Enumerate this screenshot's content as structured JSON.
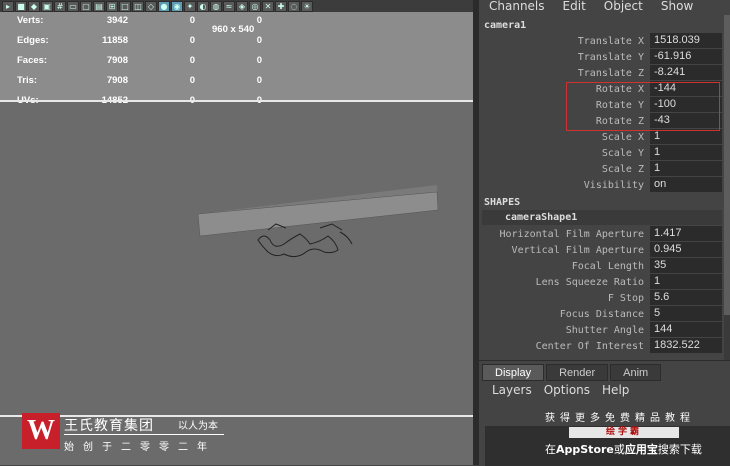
{
  "toolbar": {
    "icons": [
      "select-icon",
      "camera-icon",
      "bookmark-icon",
      "image-plane-icon",
      "grid-icon",
      "film-gate-icon",
      "resolution-gate-icon",
      "gate-mask-icon",
      "field-chart-icon",
      "safe-action-icon",
      "safe-title-icon",
      "wireframe-icon",
      "smooth-shade-icon",
      "textured-icon",
      "lights-icon",
      "shadows-icon",
      "ambient-occlusion-icon",
      "motion-blur-icon",
      "anti-alias-icon",
      "isolate-icon",
      "xray-icon",
      "xray-joints-icon",
      "xray-components-icon",
      "exposure-icon"
    ]
  },
  "hud": {
    "rows": [
      {
        "label": "Verts:",
        "v1": "3942",
        "v2": "0",
        "v3": "0"
      },
      {
        "label": "Edges:",
        "v1": "11858",
        "v2": "0",
        "v3": "0"
      },
      {
        "label": "Faces:",
        "v1": "7908",
        "v2": "0",
        "v3": "0"
      },
      {
        "label": "Tris:",
        "v1": "7908",
        "v2": "0",
        "v3": "0"
      },
      {
        "label": "UVs:",
        "v1": "14852",
        "v2": "0",
        "v3": "0"
      }
    ],
    "resolution": "960 x 540"
  },
  "watermark": {
    "logo": "W",
    "title": "王氏教育集团",
    "slogan": "以人为本",
    "subtitle": "始创于二零零二年"
  },
  "channel_box": {
    "menu": [
      "Channels",
      "Edit",
      "Object",
      "Show"
    ],
    "object_name": "camera1",
    "transform_attrs": [
      {
        "name": "Translate X",
        "value": "1518.039"
      },
      {
        "name": "Translate Y",
        "value": "-61.916"
      },
      {
        "name": "Translate Z",
        "value": "-8.241"
      },
      {
        "name": "Rotate X",
        "value": "-144"
      },
      {
        "name": "Rotate Y",
        "value": "-100"
      },
      {
        "name": "Rotate Z",
        "value": "-43"
      },
      {
        "name": "Scale X",
        "value": "1"
      },
      {
        "name": "Scale Y",
        "value": "1"
      },
      {
        "name": "Scale Z",
        "value": "1"
      },
      {
        "name": "Visibility",
        "value": "on"
      }
    ],
    "shapes_header": "SHAPES",
    "shape_name": "cameraShape1",
    "shape_attrs": [
      {
        "name": "Horizontal Film Aperture",
        "value": "1.417"
      },
      {
        "name": "Vertical Film Aperture",
        "value": "0.945"
      },
      {
        "name": "Focal Length",
        "value": "35"
      },
      {
        "name": "Lens Squeeze Ratio",
        "value": "1"
      },
      {
        "name": "F Stop",
        "value": "5.6"
      },
      {
        "name": "Focus Distance",
        "value": "5"
      },
      {
        "name": "Shutter Angle",
        "value": "144"
      },
      {
        "name": "Center Of Interest",
        "value": "1832.522"
      }
    ]
  },
  "bottom_panel": {
    "tabs": [
      "Display",
      "Render",
      "Anim"
    ],
    "menu": [
      "Layers",
      "Options",
      "Help"
    ],
    "ad_tagline": "获得更多免费精品教程",
    "ad_badge": "绘学霸",
    "ad_line_pre": "在",
    "ad_line_store": "AppStore",
    "ad_line_mid": "或",
    "ad_line_bao": "应用宝",
    "ad_line_post": "搜索下载"
  }
}
